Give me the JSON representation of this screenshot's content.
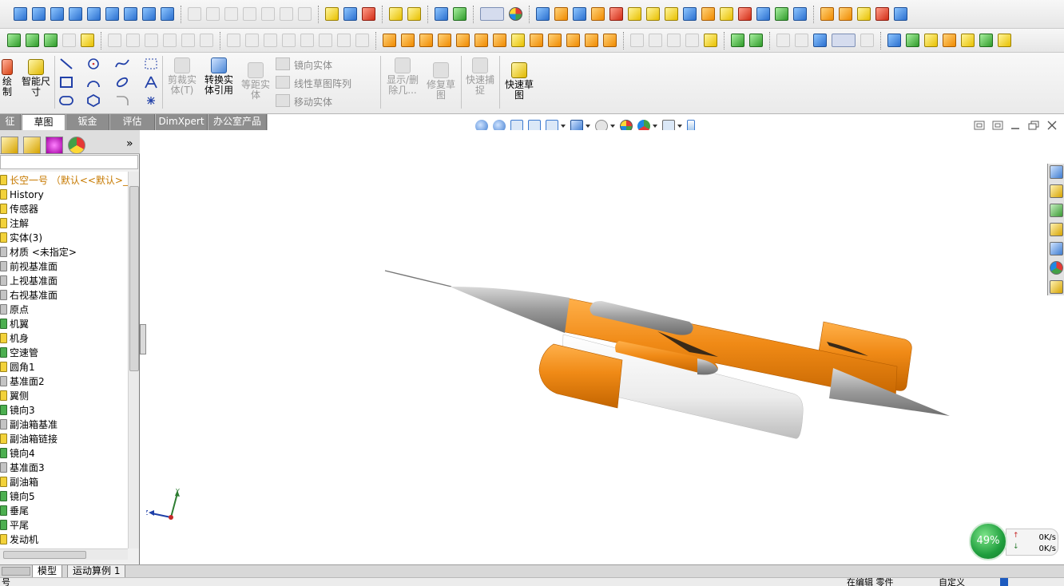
{
  "commands": {
    "sketch_draw": "绘\n制",
    "smart_dim": "智能尺\n寸",
    "trim": "剪裁实\n体(T)",
    "convert": "转换实\n体引用",
    "offset": "等距实\n体",
    "mirror": "镜向实体",
    "linear_pattern": "线性草图阵列",
    "move": "移动实体",
    "show_delete": "显示/删\n除几...",
    "repair": "修复草\n图",
    "quick_snap": "快速捕\n捉",
    "rapid_sketch": "快速草\n图"
  },
  "tabs": [
    {
      "label": "征",
      "active": false
    },
    {
      "label": "草图",
      "active": true
    },
    {
      "label": "钣金",
      "active": false
    },
    {
      "label": "评估",
      "active": false
    },
    {
      "label": "DimXpert",
      "active": false
    },
    {
      "label": "办公室产品",
      "active": false
    }
  ],
  "tree": {
    "root": "长空一号 （默认<<默认>_显",
    "items": [
      {
        "label": "History",
        "icon": "history-icon"
      },
      {
        "label": "传感器",
        "icon": "sensor-icon"
      },
      {
        "label": "注解",
        "icon": "annotation-icon"
      },
      {
        "label": "实体(3)",
        "icon": "solid-bodies-icon"
      },
      {
        "label": "材质 <未指定>",
        "icon": "material-icon"
      },
      {
        "label": "前视基准面",
        "icon": "plane-icon"
      },
      {
        "label": "上视基准面",
        "icon": "plane-icon"
      },
      {
        "label": "右视基准面",
        "icon": "plane-icon"
      },
      {
        "label": "原点",
        "icon": "origin-icon"
      },
      {
        "label": "机翼",
        "icon": "feature-icon"
      },
      {
        "label": "机身",
        "icon": "revolve-icon"
      },
      {
        "label": "空速管",
        "icon": "feature-icon"
      },
      {
        "label": "圆角1",
        "icon": "fillet-icon"
      },
      {
        "label": "基准面2",
        "icon": "plane-icon"
      },
      {
        "label": "翼侧",
        "icon": "revolve-icon"
      },
      {
        "label": "镜向3",
        "icon": "mirror-icon"
      },
      {
        "label": "副油箱基准",
        "icon": "plane-icon"
      },
      {
        "label": "副油箱链接",
        "icon": "revolve-icon"
      },
      {
        "label": "镜向4",
        "icon": "mirror-icon"
      },
      {
        "label": "基准面3",
        "icon": "plane-icon"
      },
      {
        "label": "副油箱",
        "icon": "revolve-icon"
      },
      {
        "label": "镜向5",
        "icon": "mirror-icon"
      },
      {
        "label": "垂尾",
        "icon": "feature-icon"
      },
      {
        "label": "平尾",
        "icon": "feature-icon"
      },
      {
        "label": "发动机",
        "icon": "revolve-icon"
      }
    ]
  },
  "bottom_tabs": [
    {
      "label": "模型",
      "active": true
    },
    {
      "label": "运动算例 1",
      "active": false
    }
  ],
  "status": {
    "left": "号",
    "editing": "在编辑 零件",
    "custom": "自定义"
  },
  "triad": {
    "y": "Y",
    "z": "Z"
  },
  "net": {
    "percent": "49%",
    "up": "0K/s",
    "down": "0K/s"
  },
  "colors": {
    "body_orange": "#f08a16",
    "nose_gray": "#8c8c8c",
    "tank_white": "#f2f2f2"
  }
}
